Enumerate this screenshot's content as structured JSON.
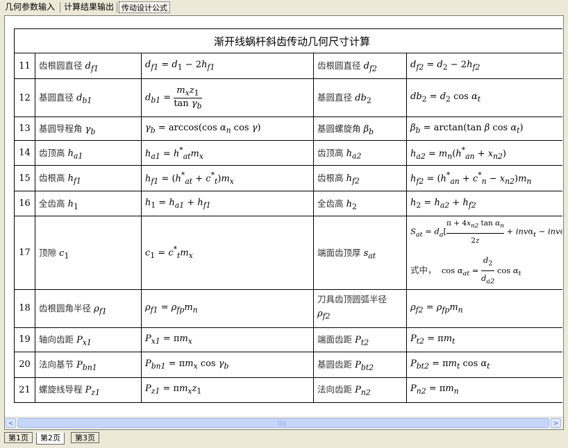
{
  "top_tabs": [
    {
      "label": "几何参数输入"
    },
    {
      "label": "计算结果输出"
    },
    {
      "label": "传动设计公式"
    }
  ],
  "table": {
    "title": "渐开线蜗杆斜齿传动几何尺寸计算",
    "rows": [
      {
        "no": "11",
        "name_a": "齿根圆直径 d_f1",
        "formula_a": "d_f1 = d_1 − 2h_f1",
        "name_b": "齿根圆直径 d_f2",
        "formula_b": "d_f2 = d_2 − 2h_f2"
      },
      {
        "no": "12",
        "name_a": "基圆直径 d_b1",
        "formula_a": "d_b1 = m_x z_1 / tan γ_b",
        "name_b": "基圆直径 db_2",
        "formula_b": "db_2 = d_2 cos α_t"
      },
      {
        "no": "13",
        "name_a": "基圆导程角 γ_b",
        "formula_a": "γ_b = arccos(cos α_n cos γ)",
        "name_b": "基圆螺旋角 β_b",
        "formula_b": "β_b = arctan(tan β cos α_t)"
      },
      {
        "no": "14",
        "name_a": "齿顶高 h_a1",
        "formula_a": "h_a1 = h*_at m_x",
        "name_b": "齿顶高 h_a2",
        "formula_b": "h_a2 = m_n(h*_an + x_n2)"
      },
      {
        "no": "15",
        "name_a": "齿根高 h_f1",
        "formula_a": "h_f1 = (h*_at + c*_t) m_x",
        "name_b": "齿根高 h_f2",
        "formula_b": "h_f2 = (h*_an + c*_n − x_n2) m_n"
      },
      {
        "no": "16",
        "name_a": "全齿高 h_1",
        "formula_a": "h_1 = h_a1 + h_f1",
        "name_b": "全齿高 h_2",
        "formula_b": "h_2 = h_a2 + h_f2"
      },
      {
        "no": "17",
        "name_a": "顶隙 c_1",
        "formula_a": "c_1 = c*_t m_x",
        "name_b": "端面齿顶厚 s_at",
        "formula_b": "S_at = d_a[(π + 4x_n2 tan α_n)/2z + invα_t − invα_at]",
        "formula_b2": "式中，  cos α_at = (d_2/d_a2) cos α_t"
      },
      {
        "no": "18",
        "name_a": "齿根圆角半径 ρ_f1",
        "formula_a": "ρ_f1 = ρ_fp m_n",
        "name_b": "刀具齿顶圆弧半径 ρ_f2",
        "formula_b": "ρ_f2 = ρ_fp m_n"
      },
      {
        "no": "19",
        "name_a": "轴向齿距 P_x1",
        "formula_a": "P_x1 = π m_x",
        "name_b": "端面齿距 P_t2",
        "formula_b": "P_t2 = π m_t"
      },
      {
        "no": "20",
        "name_a": "法向基节 P_bn1",
        "formula_a": "P_bn1 = π m_x cos γ_b",
        "name_b": "基圆齿距 P_bt2",
        "formula_b": "P_bt2 = π m_t cos α_t"
      },
      {
        "no": "21",
        "name_a": "螺旋线导程 P_z1",
        "formula_a": "P_z1 = π m_x z_1",
        "name_b": "法向齿距 P_n2",
        "formula_b": "P_n2 = π m_n"
      }
    ]
  },
  "bottom_tabs": [
    {
      "label": "第1页"
    },
    {
      "label": "第2页"
    },
    {
      "label": "第3页"
    }
  ],
  "scrollbar": {
    "left_arrow": "<",
    "right_arrow": ">",
    "position": 0
  }
}
